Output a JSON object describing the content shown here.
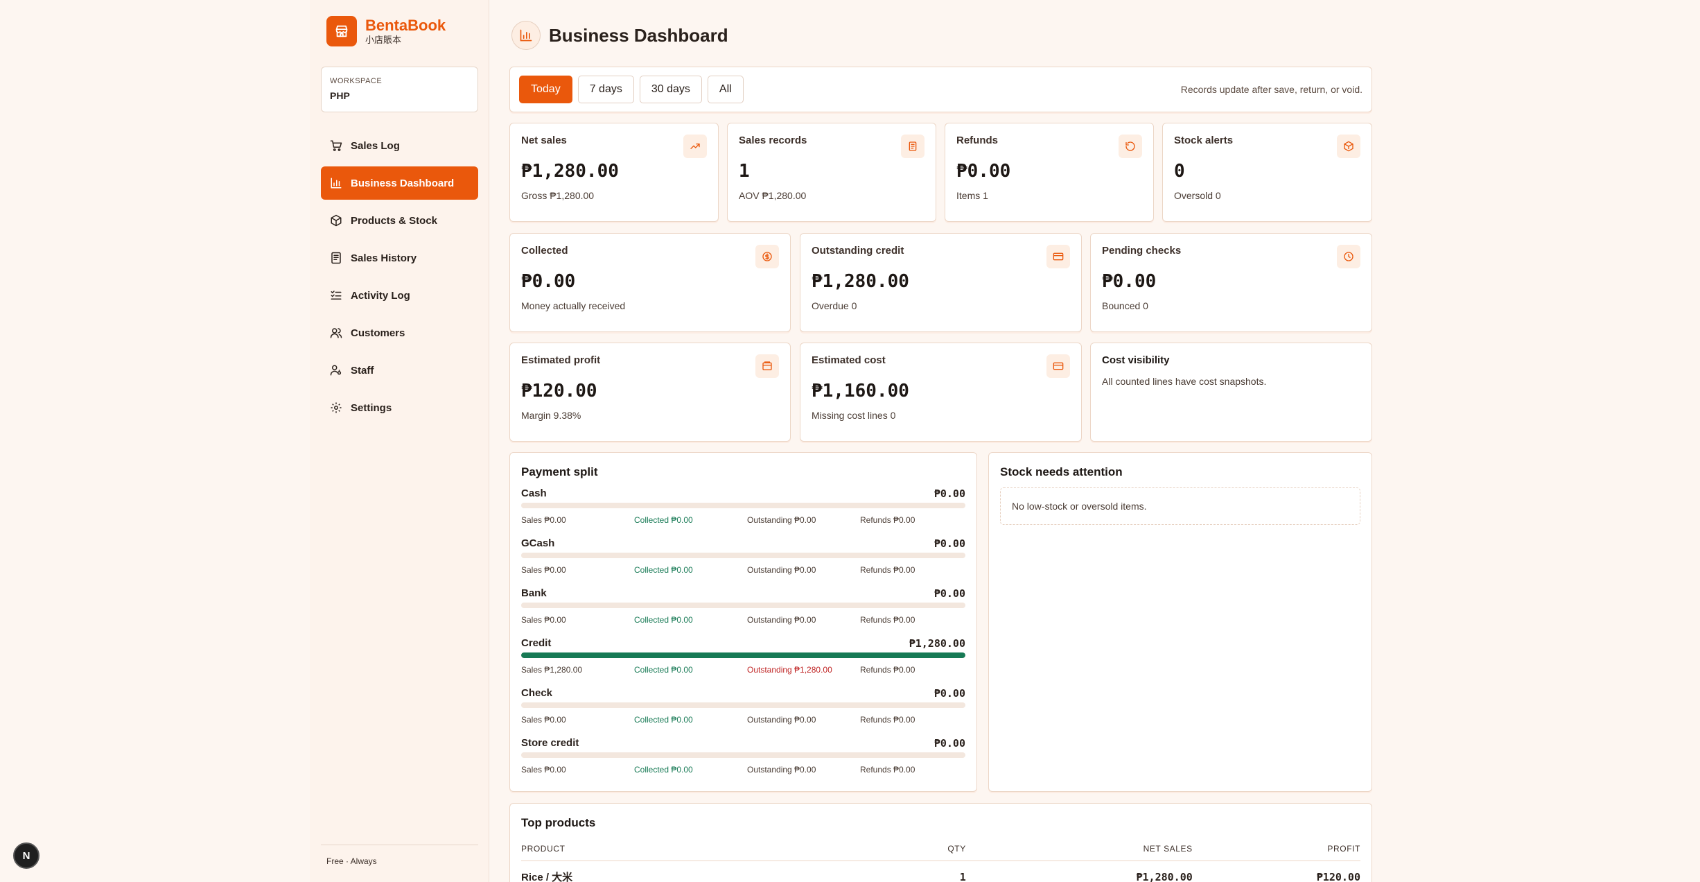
{
  "app": {
    "name": "BentaBook",
    "subtitle": "小店賬本",
    "brand_color": "#ea580c",
    "accent_green": "#177a55",
    "alert_red": "#c02626"
  },
  "workspace": {
    "label": "WORKSPACE",
    "value": "PHP"
  },
  "nav": [
    {
      "label": "Sales Log",
      "icon": "cart-icon",
      "active": false
    },
    {
      "label": "Business Dashboard",
      "icon": "bar-chart-icon",
      "active": true
    },
    {
      "label": "Products & Stock",
      "icon": "box-icon",
      "active": false
    },
    {
      "label": "Sales History",
      "icon": "receipt-icon",
      "active": false
    },
    {
      "label": "Activity Log",
      "icon": "checklist-icon",
      "active": false
    },
    {
      "label": "Customers",
      "icon": "users-icon",
      "active": false
    },
    {
      "label": "Staff",
      "icon": "user-key-icon",
      "active": false
    },
    {
      "label": "Settings",
      "icon": "gear-icon",
      "active": false
    }
  ],
  "sidebar_footer": "Free · Always",
  "floating_badge": "N",
  "page": {
    "title": "Business Dashboard"
  },
  "filters": {
    "options": [
      "Today",
      "7 days",
      "30 days",
      "All"
    ],
    "selected": "Today",
    "note": "Records update after save, return, or void."
  },
  "stats_row1": [
    {
      "label": "Net sales",
      "value": "₱1,280.00",
      "sub": "Gross ₱1,280.00",
      "icon": "trend-up-icon"
    },
    {
      "label": "Sales records",
      "value": "1",
      "sub": "AOV ₱1,280.00",
      "icon": "document-icon"
    },
    {
      "label": "Refunds",
      "value": "₱0.00",
      "sub": "Items 1",
      "icon": "undo-icon"
    },
    {
      "label": "Stock alerts",
      "value": "0",
      "sub": "Oversold 0",
      "icon": "package-alert-icon"
    }
  ],
  "stats_row2": [
    {
      "label": "Collected",
      "value": "₱0.00",
      "sub": "Money actually received",
      "icon": "coin-icon"
    },
    {
      "label": "Outstanding credit",
      "value": "₱1,280.00",
      "sub": "Overdue 0",
      "icon": "credit-card-icon"
    },
    {
      "label": "Pending checks",
      "value": "₱0.00",
      "sub": "Bounced 0",
      "icon": "clock-icon"
    }
  ],
  "stats_row3": [
    {
      "label": "Estimated profit",
      "value": "₱120.00",
      "sub": "Margin 9.38%",
      "icon": "wallet-icon"
    },
    {
      "label": "Estimated cost",
      "value": "₱1,160.00",
      "sub": "Missing cost lines 0",
      "icon": "credit-card-icon"
    }
  ],
  "cost_visibility": {
    "title": "Cost visibility",
    "text": "All counted lines have cost snapshots."
  },
  "payment_split": {
    "title": "Payment split",
    "rows": [
      {
        "name": "Cash",
        "amount": "₱0.00",
        "fill": 0,
        "sales": "Sales ₱0.00",
        "collected": "Collected ₱0.00",
        "outstanding": "Outstanding ₱0.00",
        "refunds": "Refunds ₱0.00",
        "outstanding_alert": false
      },
      {
        "name": "GCash",
        "amount": "₱0.00",
        "fill": 0,
        "sales": "Sales ₱0.00",
        "collected": "Collected ₱0.00",
        "outstanding": "Outstanding ₱0.00",
        "refunds": "Refunds ₱0.00",
        "outstanding_alert": false
      },
      {
        "name": "Bank",
        "amount": "₱0.00",
        "fill": 0,
        "sales": "Sales ₱0.00",
        "collected": "Collected ₱0.00",
        "outstanding": "Outstanding ₱0.00",
        "refunds": "Refunds ₱0.00",
        "outstanding_alert": false
      },
      {
        "name": "Credit",
        "amount": "₱1,280.00",
        "fill": 1,
        "sales": "Sales ₱1,280.00",
        "collected": "Collected ₱0.00",
        "outstanding": "Outstanding ₱1,280.00",
        "refunds": "Refunds ₱0.00",
        "outstanding_alert": true
      },
      {
        "name": "Check",
        "amount": "₱0.00",
        "fill": 0,
        "sales": "Sales ₱0.00",
        "collected": "Collected ₱0.00",
        "outstanding": "Outstanding ₱0.00",
        "refunds": "Refunds ₱0.00",
        "outstanding_alert": false
      },
      {
        "name": "Store credit",
        "amount": "₱0.00",
        "fill": 0,
        "sales": "Sales ₱0.00",
        "collected": "Collected ₱0.00",
        "outstanding": "Outstanding ₱0.00",
        "refunds": "Refunds ₱0.00",
        "outstanding_alert": false
      }
    ]
  },
  "stock_attention": {
    "title": "Stock needs attention",
    "empty": "No low-stock or oversold items."
  },
  "top_products": {
    "title": "Top products",
    "columns": [
      "PRODUCT",
      "QTY",
      "NET SALES",
      "PROFIT"
    ],
    "rows": [
      {
        "product": "Rice / 大米",
        "qty": "1",
        "net_sales": "₱1,280.00",
        "profit": "₱120.00"
      }
    ]
  }
}
